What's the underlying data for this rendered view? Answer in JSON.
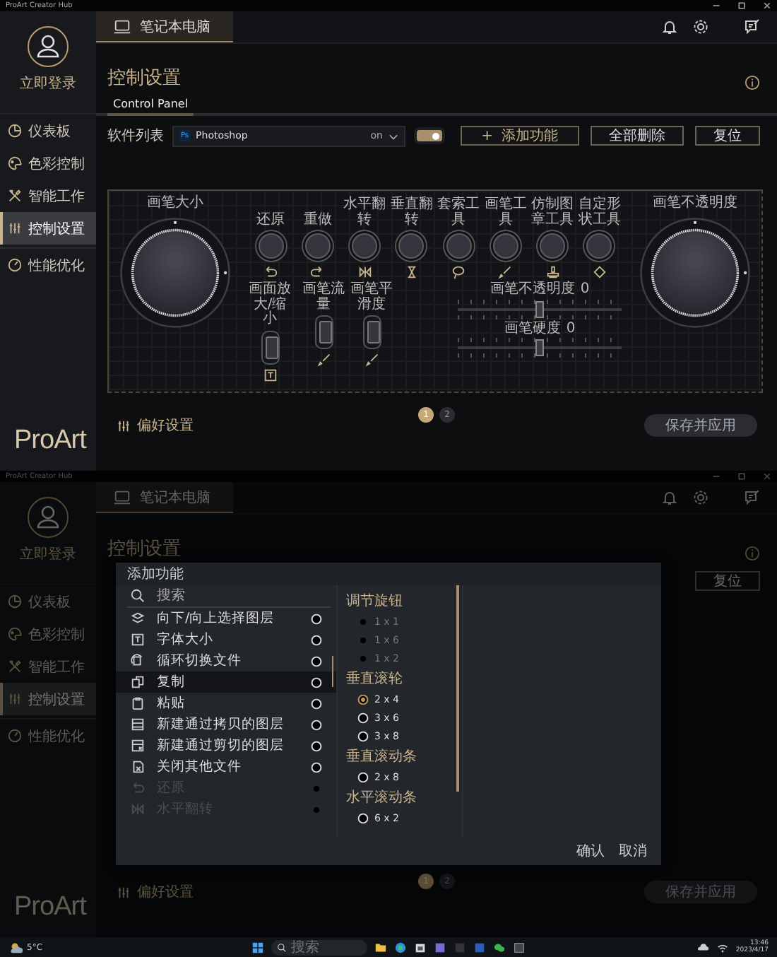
{
  "screens": [
    {
      "title_bar": "ProArt Creator Hub",
      "device_tab": "笔记本电脑",
      "login": "立即登录",
      "nav": [
        {
          "label": "仪表板",
          "selected": false
        },
        {
          "label": "色彩控制",
          "selected": false
        },
        {
          "label": "智能工作",
          "selected": false
        },
        {
          "label": "控制设置",
          "selected": true
        },
        {
          "label": "性能优化",
          "selected": false
        }
      ],
      "page_title": "控制设置",
      "tabs": [
        {
          "label": "Control Panel",
          "selected": true
        }
      ],
      "software": {
        "label": "软件列表",
        "app_badge": "Ps",
        "app": "Photoshop",
        "value": "on",
        "toggle_on": true
      },
      "actions": [
        {
          "label": "添加功能",
          "plus": "+"
        },
        {
          "label": "全部删除"
        },
        {
          "label": "复位"
        }
      ],
      "panel": {
        "left_dial": "画笔大小",
        "right_dial": "画笔不透明度",
        "knobs": [
          {
            "label": "还原"
          },
          {
            "label": "重做"
          },
          {
            "label": "水平翻转"
          },
          {
            "label": "垂直翻转"
          },
          {
            "label": "套索工具"
          },
          {
            "label": "画笔工具"
          },
          {
            "label": "仿制图章工具"
          },
          {
            "label": "自定形状工具"
          }
        ],
        "rockers": [
          {
            "label": "画面放大/缩小",
            "level": 0.5
          },
          {
            "label": "画笔流量",
            "level": 0.5
          },
          {
            "label": "画笔平滑度",
            "level": 0.5
          }
        ],
        "sliders": [
          {
            "label": "画笔不透明度",
            "reading": "0",
            "level": 0.5
          },
          {
            "label": "画笔硬度",
            "reading": "0",
            "level": 0.5
          }
        ]
      },
      "footer": {
        "prefs": "偏好设置",
        "pages": [
          {
            "label": "1",
            "selected": true
          },
          {
            "label": "2",
            "selected": false
          }
        ],
        "save": "保存并应用"
      },
      "logo": "ProArt"
    },
    {
      "title_bar": "ProArt Creator Hub",
      "device_tab": "笔记本电脑",
      "login": "立即登录",
      "nav": [
        {
          "label": "仪表板",
          "selected": false
        },
        {
          "label": "色彩控制",
          "selected": false
        },
        {
          "label": "智能工作",
          "selected": false
        },
        {
          "label": "控制设置",
          "selected": true
        },
        {
          "label": "性能优化",
          "selected": false
        }
      ],
      "page_title": "控制设置",
      "actions": [
        {
          "label": "复位"
        }
      ],
      "footer": {
        "prefs": "偏好设置",
        "pages": [
          {
            "label": "1",
            "selected": true
          },
          {
            "label": "2",
            "selected": false
          }
        ],
        "save": "保存并应用"
      },
      "logo": "ProArt",
      "modal": {
        "title": "添加功能",
        "search_placeholder": "搜索",
        "items": [
          {
            "label": "向下/向上选择图层",
            "selected": false,
            "disabled": false
          },
          {
            "label": "字体大小",
            "selected": false,
            "disabled": false
          },
          {
            "label": "循环切换文件",
            "selected": false,
            "disabled": false
          },
          {
            "label": "复制",
            "selected": true,
            "disabled": false
          },
          {
            "label": "粘贴",
            "selected": false,
            "disabled": false
          },
          {
            "label": "新建通过拷贝的图层",
            "selected": false,
            "disabled": false
          },
          {
            "label": "新建通过剪切的图层",
            "selected": false,
            "disabled": false
          },
          {
            "label": "关闭其他文件",
            "selected": false,
            "disabled": false
          },
          {
            "label": "还原",
            "selected": false,
            "disabled": true
          },
          {
            "label": "水平翻转",
            "selected": false,
            "disabled": true
          }
        ],
        "groups": [
          {
            "title": "调节旋钮",
            "options": [
              {
                "label": "1 x 1",
                "selected": false,
                "disabled": true
              },
              {
                "label": "1 x 6",
                "selected": false,
                "disabled": true
              },
              {
                "label": "1 x 2",
                "selected": false,
                "disabled": true
              }
            ]
          },
          {
            "title": "垂直滚轮",
            "options": [
              {
                "label": "2 x 4",
                "selected": true,
                "disabled": false
              },
              {
                "label": "3 x 6",
                "selected": false,
                "disabled": false
              },
              {
                "label": "3 x 8",
                "selected": false,
                "disabled": false
              }
            ]
          },
          {
            "title": "垂直滚动条",
            "options": [
              {
                "label": "2 x 8",
                "selected": false,
                "disabled": false
              }
            ]
          },
          {
            "title": "水平滚动条",
            "options": [
              {
                "label": "6 x 2",
                "selected": false,
                "disabled": false
              }
            ]
          }
        ],
        "confirm": "确认",
        "cancel": "取消"
      }
    }
  ],
  "taskbar": {
    "weather": "5°C",
    "search_placeholder": "搜索",
    "time": "13:46",
    "date": "2023/4/17"
  }
}
